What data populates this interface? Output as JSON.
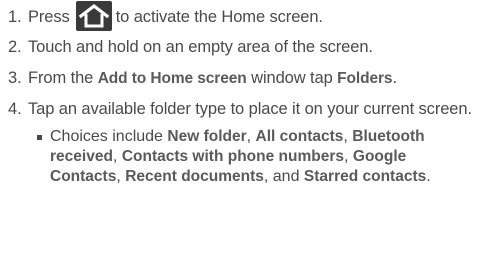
{
  "steps": [
    {
      "number": "1.",
      "before": "Press",
      "icon": "home-icon",
      "after": "to activate the Home screen."
    },
    {
      "number": "2.",
      "text": "Touch and hold on an empty area of the screen."
    },
    {
      "number": "3.",
      "t1": "From the",
      "b1": "Add to Home screen",
      "t2": "window tap",
      "b2": "Folders",
      "t3": "."
    },
    {
      "number": "4.",
      "text": "Tap an available folder type to place it on your current screen."
    }
  ],
  "choices": {
    "intro": "Choices include",
    "items": [
      "New folder",
      "All contacts",
      "Bluetooth received",
      "Contacts with phone numbers",
      "Google Contacts",
      "Recent documents",
      "Starred contacts"
    ],
    "sep": ", ",
    "and": ", and ",
    "end": "."
  }
}
